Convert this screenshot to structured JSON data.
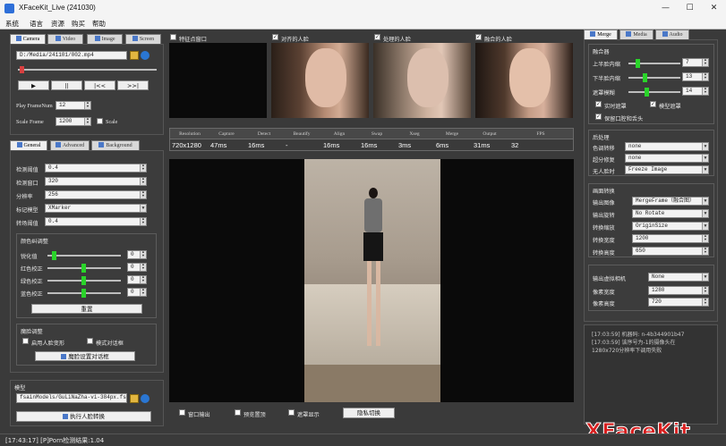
{
  "window": {
    "title": "XFaceKit_Live (241030)"
  },
  "menu": [
    "系统",
    "语言",
    "资源",
    "购买",
    "帮助"
  ],
  "left_tabs": [
    "Camera",
    "Video",
    "Image",
    "Screen"
  ],
  "video": {
    "path": "D:/Media/241101/002.mp4",
    "play_frame_label": "Play FrameNum",
    "play_frame_value": "12",
    "scale_frame_label": "Scale Frame",
    "scale_frame_value": "1200",
    "scale_check_label": "Scale",
    "controls": [
      "▶",
      "||",
      "|<<",
      ">>|"
    ]
  },
  "settings_tabs": [
    "General",
    "Advanced",
    "Background"
  ],
  "general": {
    "rows": [
      {
        "label": "检测阈值",
        "value": "0.4"
      },
      {
        "label": "检测窗口",
        "value": "320"
      },
      {
        "label": "分辨率",
        "value": "256"
      },
      {
        "label": "标记模型",
        "value": "XMarker"
      },
      {
        "label": "转场阈值",
        "value": "0.4"
      }
    ]
  },
  "color_group": {
    "title": "颜色纠调整",
    "rows": [
      {
        "label": "锐化值",
        "value": "0",
        "level": 0.06
      },
      {
        "label": "红色校正",
        "value": "0",
        "level": 0.5
      },
      {
        "label": "绿色校正",
        "value": "0",
        "level": 0.5
      },
      {
        "label": "蓝色校正",
        "value": "0",
        "level": 0.5
      }
    ],
    "reset": "重置"
  },
  "face_group": {
    "title": "魔脸调整",
    "check1": "启用人脸变形",
    "check2": "模式对话框",
    "button": "魔脸设置对话框"
  },
  "model": {
    "title": "模型",
    "path": "fsainModels/GuLiNaZha-vi-384px.fsm",
    "run_button": "执行人脸转换"
  },
  "preview": {
    "checks": [
      {
        "label": "特征点窗口",
        "checked": false
      },
      {
        "label": "对齐的人脸",
        "checked": true
      },
      {
        "label": "处理的人脸",
        "checked": true
      },
      {
        "label": "融合的人脸",
        "checked": true
      }
    ]
  },
  "stats": {
    "headers": [
      "Resolution",
      "Capture",
      "Detect",
      "Beautify",
      "Align",
      "Swap",
      "Xseg",
      "Merge",
      "Output",
      "FPS"
    ],
    "values": [
      "720x1280",
      "47ms",
      "16ms",
      "-",
      "16ms",
      "16ms",
      "3ms",
      "6ms",
      "31ms",
      "32"
    ]
  },
  "bottom_checks": [
    {
      "label": "窗口输出",
      "checked": false
    },
    {
      "label": "预览置顶",
      "checked": false
    },
    {
      "label": "遮罩显示",
      "checked": false
    }
  ],
  "privacy_button": "隐私切换",
  "right_tabs": [
    "Merge",
    "Media",
    "Audio"
  ],
  "fusion": {
    "title": "融合器",
    "rows": [
      {
        "label": "上半脸内缩",
        "value": "7",
        "level": 0.18
      },
      {
        "label": "下半脸内缩",
        "value": "13",
        "level": 0.32
      },
      {
        "label": "遮罩模糊",
        "value": "14",
        "level": 0.35
      }
    ],
    "checks": [
      {
        "label": "实时遮罩",
        "checked": true
      },
      {
        "label": "模型遮罩",
        "checked": true
      },
      {
        "label": "保留口腔和舌头",
        "checked": true
      }
    ]
  },
  "post": {
    "title": "后处理",
    "rows": [
      {
        "label": "色调转移",
        "value": "none"
      },
      {
        "label": "超分修复",
        "value": "none"
      },
      {
        "label": "无人脸时",
        "value": "Freeze Image"
      }
    ]
  },
  "output_setting": {
    "title": "画面转换",
    "rows": [
      {
        "label": "输出图像",
        "value": "MergeFrame（融合图）"
      },
      {
        "label": "输出旋转",
        "value": "No Rotate"
      },
      {
        "label": "转换缩放",
        "value": "OriginSize"
      },
      {
        "label": "转换宽度",
        "value": "1200"
      },
      {
        "label": "转换高度",
        "value": "650"
      }
    ]
  },
  "camera_out": {
    "label": "输出虚拟相机",
    "value": "None",
    "width_label": "像素宽度",
    "width_value": "1280",
    "height_label": "像素高度",
    "height_value": "720"
  },
  "log": [
    "[17:03:59] 机器码: n-4b344901b47",
    "[17:03:59] 该序号为-1的摄像头在",
    "1280x720分辨率下调用失败"
  ],
  "status": "[17:43:17] [P]Porn检测结果:1.04",
  "watermark": "XFaceKit",
  "colors": {
    "accent_green": "#2ad42a",
    "watermark_red": "#d81e1e",
    "background": "#3a3a3a"
  }
}
